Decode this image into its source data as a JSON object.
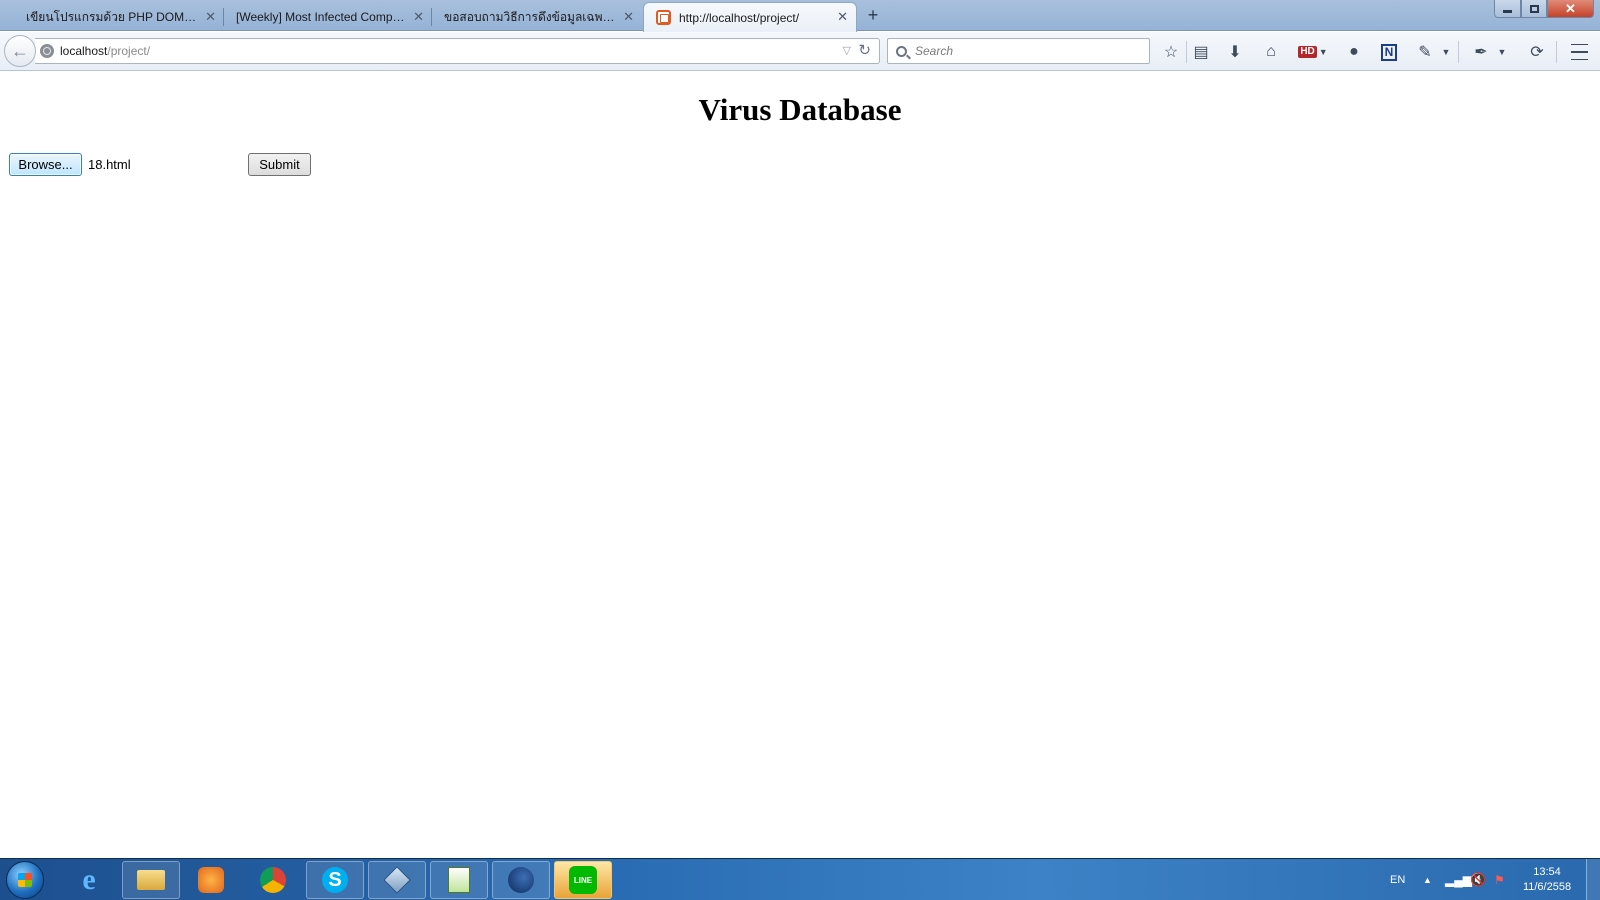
{
  "browser": {
    "tabs": [
      {
        "label": "เขียนโปรแกรมด้วย PHP DOM เพื่..."
      },
      {
        "label": "[Weekly] Most Infected Compu..."
      },
      {
        "label": "ขอสอบถามวิธีการดึงข้อมูลเฉพาะส่..."
      },
      {
        "label": "http://localhost/project/"
      }
    ],
    "active_tab_index": 3,
    "url_host": "localhost",
    "url_path": "/project/",
    "search_placeholder": "Search",
    "toolbar_icons": [
      "bookmark-star-icon",
      "reading-list-icon",
      "download-icon",
      "home-icon",
      "hd-addon-icon",
      "chat-icon",
      "n-addon-icon",
      "addon-icon",
      "eyedropper-icon",
      "sync-icon",
      "menu-icon"
    ],
    "hd_label": "HD",
    "n_label": "N"
  },
  "page": {
    "title": "Virus Database",
    "browse_label": "Browse...",
    "file_name": "18.html",
    "submit_label": "Submit"
  },
  "taskbar": {
    "apps": [
      "internet-explorer",
      "file-explorer",
      "media-player",
      "chrome",
      "skype",
      "virtualbox",
      "notepad-plus-plus",
      "firefox",
      "line"
    ],
    "language": "EN",
    "time": "13:54",
    "date": "11/6/2558"
  },
  "colors": {
    "accent": "#3c7fb1",
    "taskbar": "#2a6db4",
    "close_button": "#c5422a"
  }
}
